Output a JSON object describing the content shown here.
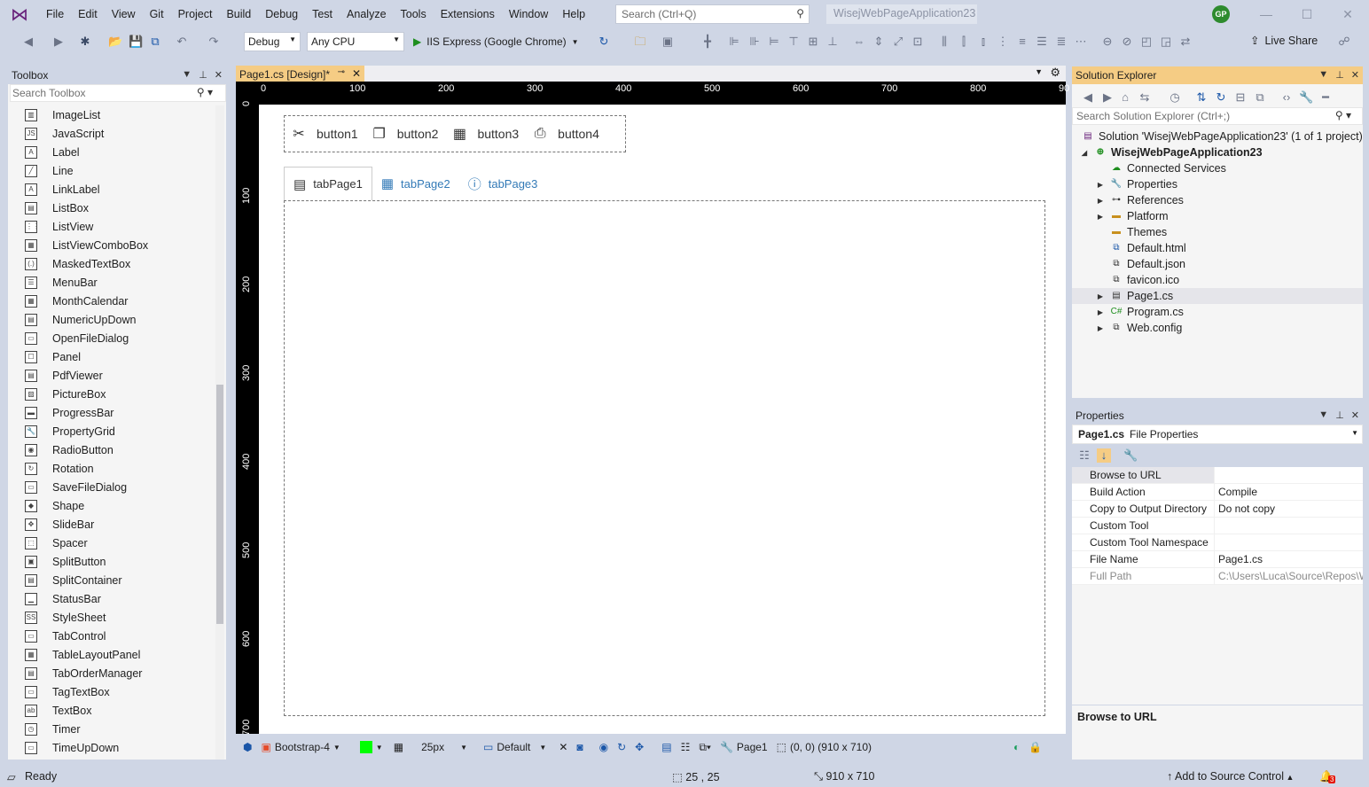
{
  "menu": [
    "File",
    "Edit",
    "View",
    "Git",
    "Project",
    "Build",
    "Debug",
    "Test",
    "Analyze",
    "Tools",
    "Extensions",
    "Window",
    "Help"
  ],
  "search": {
    "placeholder": "Search (Ctrl+Q)"
  },
  "solution_name": "WisejWebPageApplication23",
  "avatar": "GP",
  "toolbar": {
    "config": "Debug",
    "platform": "Any CPU",
    "run_target": "IIS Express (Google Chrome)",
    "live_share": "Live Share"
  },
  "toolbox": {
    "title": "Toolbox",
    "search_placeholder": "Search Toolbox",
    "items": [
      {
        "label": "ImageList",
        "icon": "imagelist-icon"
      },
      {
        "label": "JavaScript",
        "icon": "javascript-icon"
      },
      {
        "label": "Label",
        "icon": "label-icon"
      },
      {
        "label": "Line",
        "icon": "line-icon"
      },
      {
        "label": "LinkLabel",
        "icon": "linklabel-icon"
      },
      {
        "label": "ListBox",
        "icon": "listbox-icon"
      },
      {
        "label": "ListView",
        "icon": "listview-icon"
      },
      {
        "label": "ListViewComboBox",
        "icon": "listviewcombobox-icon"
      },
      {
        "label": "MaskedTextBox",
        "icon": "maskedtextbox-icon"
      },
      {
        "label": "MenuBar",
        "icon": "menubar-icon"
      },
      {
        "label": "MonthCalendar",
        "icon": "monthcalendar-icon"
      },
      {
        "label": "NumericUpDown",
        "icon": "numericupdown-icon"
      },
      {
        "label": "OpenFileDialog",
        "icon": "openfiledialog-icon"
      },
      {
        "label": "Panel",
        "icon": "panel-icon"
      },
      {
        "label": "PdfViewer",
        "icon": "pdfviewer-icon"
      },
      {
        "label": "PictureBox",
        "icon": "picturebox-icon"
      },
      {
        "label": "ProgressBar",
        "icon": "progressbar-icon"
      },
      {
        "label": "PropertyGrid",
        "icon": "propertygrid-icon"
      },
      {
        "label": "RadioButton",
        "icon": "radiobutton-icon"
      },
      {
        "label": "Rotation",
        "icon": "rotation-icon"
      },
      {
        "label": "SaveFileDialog",
        "icon": "savefiledialog-icon"
      },
      {
        "label": "Shape",
        "icon": "shape-icon"
      },
      {
        "label": "SlideBar",
        "icon": "slidebar-icon"
      },
      {
        "label": "Spacer",
        "icon": "spacer-icon"
      },
      {
        "label": "SplitButton",
        "icon": "splitbutton-icon"
      },
      {
        "label": "SplitContainer",
        "icon": "splitcontainer-icon"
      },
      {
        "label": "StatusBar",
        "icon": "statusbar-icon"
      },
      {
        "label": "StyleSheet",
        "icon": "stylesheet-icon"
      },
      {
        "label": "TabControl",
        "icon": "tabcontrol-icon"
      },
      {
        "label": "TableLayoutPanel",
        "icon": "tablelayoutpanel-icon"
      },
      {
        "label": "TabOrderManager",
        "icon": "tabordermanager-icon"
      },
      {
        "label": "TagTextBox",
        "icon": "tagtextbox-icon"
      },
      {
        "label": "TextBox",
        "icon": "textbox-icon"
      },
      {
        "label": "Timer",
        "icon": "timer-icon"
      },
      {
        "label": "TimeUpDown",
        "icon": "timeupdown-icon"
      }
    ]
  },
  "designer": {
    "tab": "Page1.cs [Design]*",
    "ruler_top": [
      "0",
      "100",
      "200",
      "300",
      "400",
      "500",
      "600",
      "700",
      "800",
      "90"
    ],
    "ruler_left": [
      "0",
      "100",
      "200",
      "300",
      "400",
      "500",
      "600",
      "700"
    ],
    "buttons": [
      {
        "label": "button1",
        "icon": "scissors-icon"
      },
      {
        "label": "button2",
        "icon": "copy-icon"
      },
      {
        "label": "button3",
        "icon": "calendar-icon"
      },
      {
        "label": "button4",
        "icon": "printer-icon"
      }
    ],
    "tabs": [
      {
        "label": "tabPage1",
        "icon": "list-icon"
      },
      {
        "label": "tabPage2",
        "icon": "grid-icon"
      },
      {
        "label": "tabPage3",
        "icon": "info-icon"
      }
    ],
    "bar": {
      "theme": "Bootstrap-4",
      "grid": "25px",
      "device": "Default",
      "page": "Page1",
      "bounds": "(0, 0) (910 x 710)"
    }
  },
  "solution_explorer": {
    "title": "Solution Explorer",
    "search_placeholder": "Search Solution Explorer (Ctrl+;)",
    "solution": "Solution 'WisejWebPageApplication23' (1 of 1 project)",
    "project": "WisejWebPageApplication23",
    "nodes": [
      {
        "label": "Connected Services",
        "expander": ""
      },
      {
        "label": "Properties",
        "expander": "▶"
      },
      {
        "label": "References",
        "expander": "▶"
      },
      {
        "label": "Platform",
        "expander": "▶"
      },
      {
        "label": "Themes",
        "expander": ""
      },
      {
        "label": "Default.html",
        "expander": ""
      },
      {
        "label": "Default.json",
        "expander": ""
      },
      {
        "label": "favicon.ico",
        "expander": ""
      },
      {
        "label": "Page1.cs",
        "expander": "▶"
      },
      {
        "label": "Program.cs",
        "expander": "▶"
      },
      {
        "label": "Web.config",
        "expander": "▶"
      }
    ]
  },
  "properties": {
    "title": "Properties",
    "object": "Page1.cs",
    "object_type": "File Properties",
    "rows": [
      {
        "name": "Browse to URL",
        "value": ""
      },
      {
        "name": "Build Action",
        "value": "Compile"
      },
      {
        "name": "Copy to Output Directory",
        "value": "Do not copy"
      },
      {
        "name": "Custom Tool",
        "value": ""
      },
      {
        "name": "Custom Tool Namespace",
        "value": ""
      },
      {
        "name": "File Name",
        "value": "Page1.cs"
      },
      {
        "name": "Full Path",
        "value": "C:\\Users\\Luca\\Source\\Repos\\W"
      }
    ],
    "description": "Browse to URL"
  },
  "status": {
    "ready": "Ready",
    "position": "25 , 25",
    "size": "910 x 710",
    "source_control": "Add to Source Control",
    "notifications": "3"
  }
}
